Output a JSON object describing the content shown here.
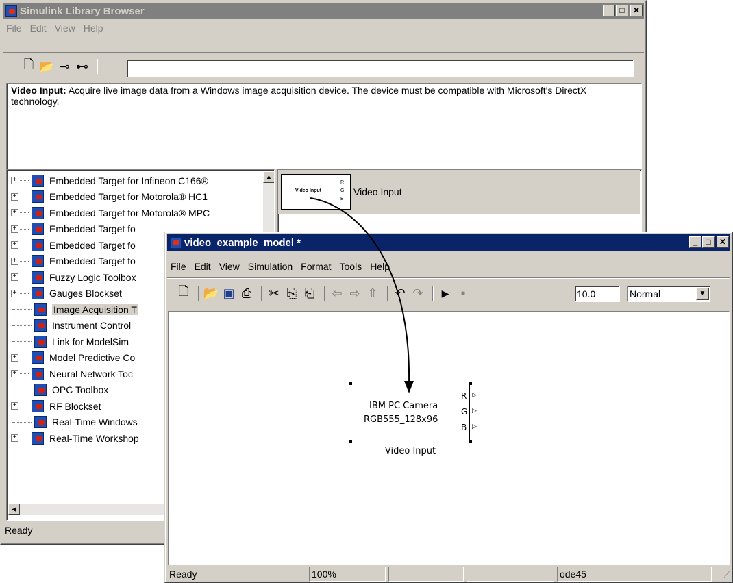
{
  "library_browser": {
    "title": "Simulink Library Browser",
    "menu": [
      "File",
      "Edit",
      "View",
      "Help"
    ],
    "search_value": "",
    "description_title": "Video Input:",
    "description_text": "Acquire live image data from a Windows image acquisition device. The device must be compatible with Microsoft's DirectX technology.",
    "tree_items": [
      {
        "label": "Embedded Target for Infineon C166®",
        "expandable": true
      },
      {
        "label": "Embedded Target for Motorola® HC1",
        "expandable": true
      },
      {
        "label": "Embedded Target for Motorola® MPC",
        "expandable": true
      },
      {
        "label": "Embedded Target fo",
        "expandable": true
      },
      {
        "label": "Embedded Target fo",
        "expandable": true
      },
      {
        "label": "Embedded Target fo",
        "expandable": true
      },
      {
        "label": "Fuzzy Logic Toolbox",
        "expandable": true
      },
      {
        "label": "Gauges Blockset",
        "expandable": true
      },
      {
        "label": "Image Acquisition T",
        "expandable": false,
        "selected": true
      },
      {
        "label": "Instrument Control",
        "expandable": false
      },
      {
        "label": "Link for ModelSim",
        "expandable": false
      },
      {
        "label": "Model Predictive Co",
        "expandable": true
      },
      {
        "label": "Neural Network Toc",
        "expandable": true
      },
      {
        "label": "OPC Toolbox",
        "expandable": false
      },
      {
        "label": "RF Blockset",
        "expandable": true
      },
      {
        "label": "Real-Time Windows",
        "expandable": false
      },
      {
        "label": "Real-Time Workshop",
        "expandable": true
      }
    ],
    "block_entry": {
      "label": "Video Input",
      "thumb_text": "Video Input",
      "ports": [
        "R",
        "G",
        "B"
      ]
    },
    "status": "Ready"
  },
  "model_window": {
    "title": "video_example_model *",
    "menu": [
      "File",
      "Edit",
      "View",
      "Simulation",
      "Format",
      "Tools",
      "Help"
    ],
    "stop_time": "10.0",
    "sim_mode": "Normal",
    "block": {
      "line1": "IBM PC Camera",
      "line2": "RGB555_128x96",
      "caption": "Video Input",
      "ports": [
        "R",
        "G",
        "B"
      ]
    },
    "status": {
      "text": "Ready",
      "zoom": "100%",
      "field3": "",
      "field4": "",
      "solver": "ode45"
    }
  },
  "icons": {
    "new": "new-file-icon",
    "open": "open-folder-icon",
    "pin": "pin-icon",
    "find": "binoculars-icon",
    "save": "save-icon",
    "print": "print-icon",
    "cut": "cut-icon",
    "copy": "copy-icon",
    "paste": "paste-icon",
    "back": "back-arrow-icon",
    "forward": "forward-arrow-icon",
    "up": "up-arrow-icon",
    "undo": "undo-icon",
    "redo": "redo-icon",
    "play": "play-icon",
    "stop": "stop-icon"
  },
  "colors": {
    "title_active": "#0a246a",
    "title_inactive": "#808080",
    "face": "#d4d0c8"
  }
}
